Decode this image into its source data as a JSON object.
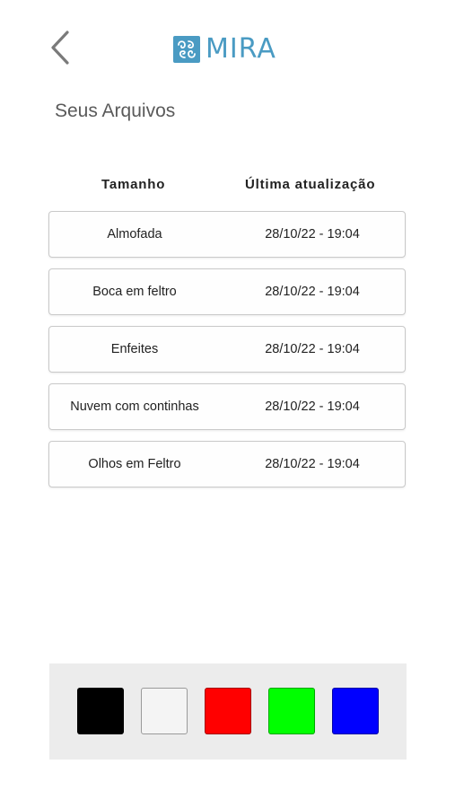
{
  "header": {
    "back_icon": "chevron-left-icon",
    "logo_text": "MIRA",
    "logo_icon": "mira-logo-icon",
    "brand_color": "#4a9bc3"
  },
  "page": {
    "title": "Seus Arquivos"
  },
  "table": {
    "columns": [
      "Tamanho",
      "Última atualização"
    ],
    "rows": [
      {
        "name": "Almofada",
        "updated": "28/10/22 - 19:04"
      },
      {
        "name": "Boca em feltro",
        "updated": "28/10/22 - 19:04"
      },
      {
        "name": "Enfeites",
        "updated": "28/10/22 - 19:04"
      },
      {
        "name": "Nuvem com continhas",
        "updated": "28/10/22 - 19:04"
      },
      {
        "name": "Olhos em Feltro",
        "updated": "28/10/22 - 19:04"
      }
    ]
  },
  "palette": {
    "colors": [
      {
        "name": "black",
        "hex": "#000000"
      },
      {
        "name": "white",
        "hex": "#f4f4f4"
      },
      {
        "name": "red",
        "hex": "#ff0000"
      },
      {
        "name": "green",
        "hex": "#00ff00"
      },
      {
        "name": "blue",
        "hex": "#0000ff"
      }
    ]
  }
}
